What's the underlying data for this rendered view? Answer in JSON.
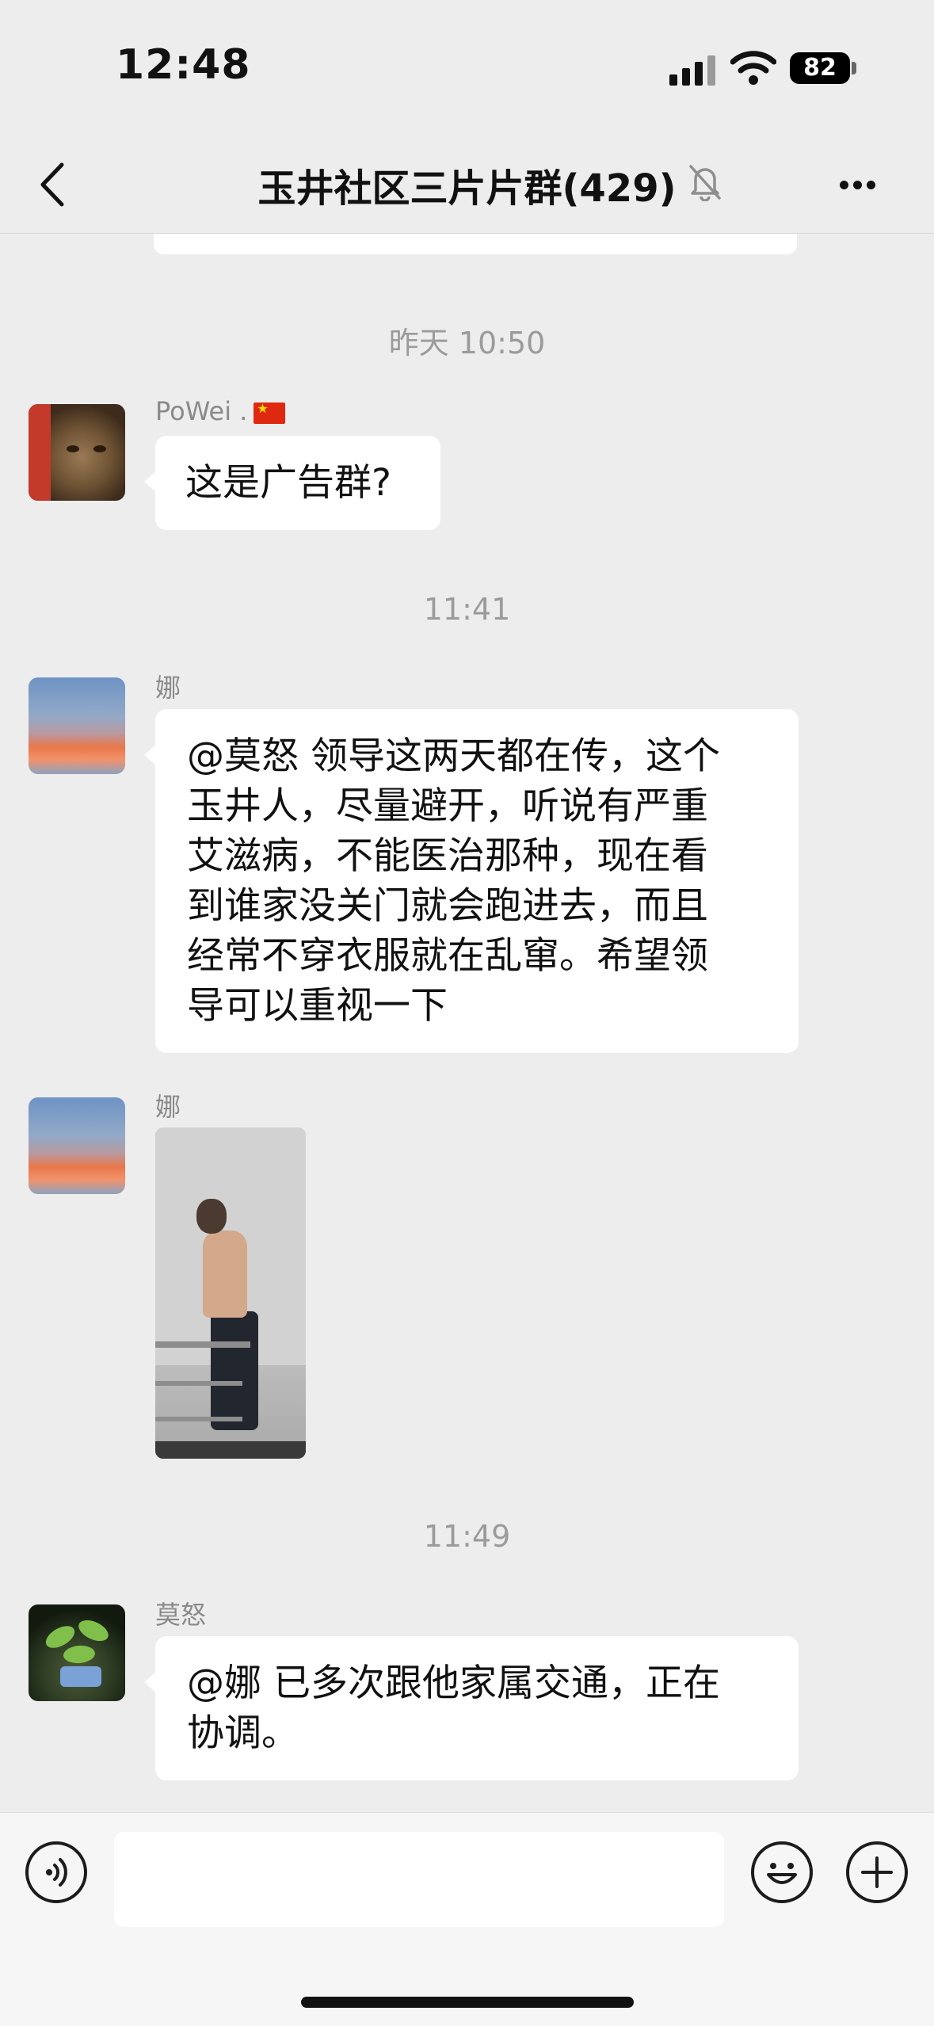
{
  "status_bar": {
    "time": "12:48",
    "battery": "82",
    "icons": [
      "cellular-signal-icon",
      "wifi-icon",
      "battery-icon"
    ]
  },
  "nav": {
    "title": "玉井社区三片片群(429)",
    "icons": [
      "back-chevron-icon",
      "mute-bell-icon",
      "more-dots-icon"
    ]
  },
  "messages": [
    {
      "type": "time",
      "text": "昨天 10:50"
    },
    {
      "type": "text",
      "sender": "PoWei .",
      "sender_flag": "china-flag-icon",
      "avatar": "cat-avatar",
      "text": "这是广告群?"
    },
    {
      "type": "time",
      "text": "11:41"
    },
    {
      "type": "text",
      "sender": "娜",
      "avatar": "sunset-avatar",
      "text": "@莫怒 领导这两天都在传，这个\n玉井人，尽量避开，听说有严重\n艾滋病，不能医治那种，现在看\n到谁家没关门就会跑进去，而且\n经常不穿衣服就在乱窜。希望领\n导可以重视一下"
    },
    {
      "type": "image",
      "sender": "娜",
      "avatar": "sunset-avatar"
    },
    {
      "type": "time",
      "text": "11:49"
    },
    {
      "type": "text",
      "sender": "莫怒",
      "avatar": "plant-avatar",
      "text": "@娜 已多次跟他家属交通，正在\n协调。"
    }
  ],
  "input_bar": {
    "placeholder": "",
    "icons": [
      "voice-icon",
      "emoji-icon",
      "plus-icon"
    ]
  },
  "colors": {
    "background": "#ededed",
    "bubble": "#ffffff",
    "input_bar": "#f6f6f6",
    "meta_text": "#9b9b9b"
  }
}
